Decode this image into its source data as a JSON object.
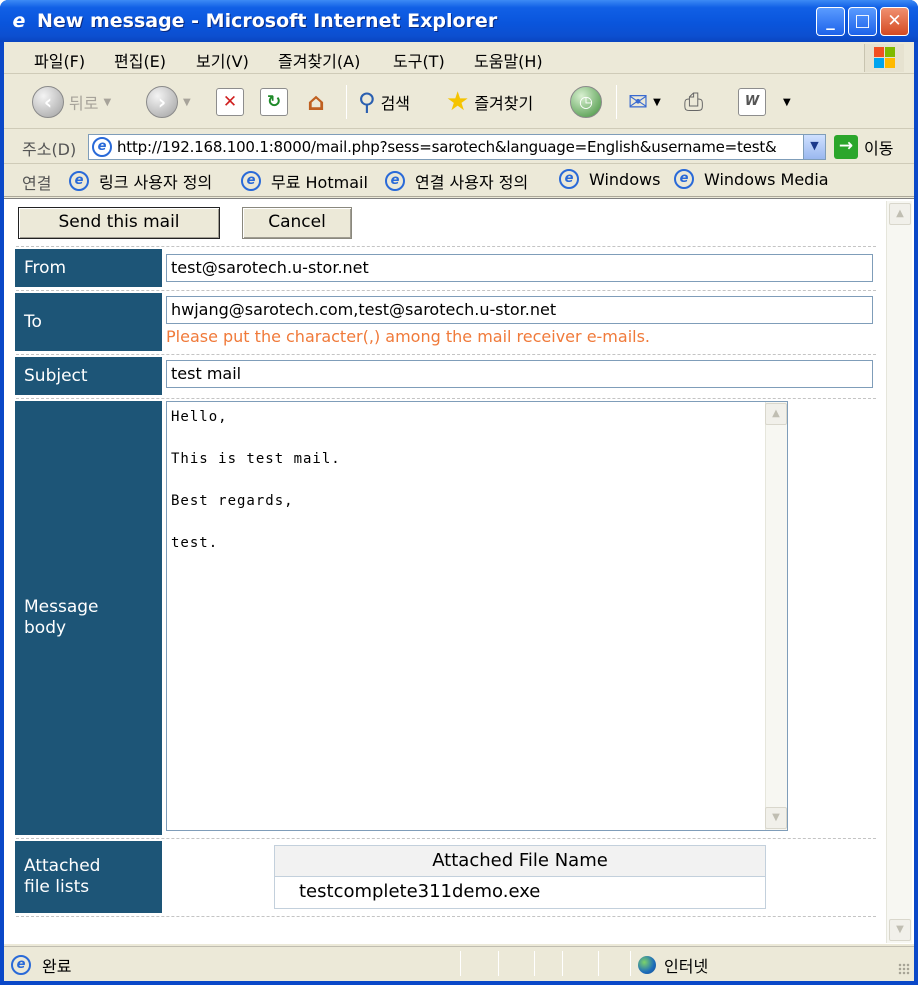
{
  "window": {
    "title": "New message - Microsoft Internet Explorer"
  },
  "menubar": {
    "items": [
      "파일(F)",
      "편집(E)",
      "보기(V)",
      "즐겨찾기(A)",
      "도구(T)",
      "도움말(H)"
    ]
  },
  "toolbar": {
    "back_label": "뒤로",
    "search_label": "검색",
    "favorites_label": "즐겨찾기"
  },
  "address": {
    "label": "주소(D)",
    "url": "http://192.168.100.1:8000/mail.php?sess=sarotech&language=English&username=test&",
    "go_label": "이동"
  },
  "links": {
    "label": "연결",
    "items": [
      "링크 사용자 정의",
      "무료 Hotmail",
      "연결 사용자 정의",
      "Windows",
      "Windows Media"
    ]
  },
  "compose": {
    "send_button": "Send this mail",
    "cancel_button": "Cancel",
    "from_label": "From",
    "from_value": "test@sarotech.u-stor.net",
    "to_label": "To",
    "to_value": "hwjang@sarotech.com,test@sarotech.u-stor.net",
    "to_hint": "Please put the character(,) among the mail receiver e-mails.",
    "subject_label": "Subject",
    "subject_value": "test mail",
    "body_label_line1": "Message",
    "body_label_line2": "body",
    "body_lines": [
      "Hello,",
      "This is test mail.",
      "Best regards,",
      "test."
    ],
    "attach_label_line1": "Attached",
    "attach_label_line2": "file lists",
    "attach_header": "Attached File Name",
    "attach_files": [
      "testcomplete311demo.exe"
    ]
  },
  "status": {
    "ready": "완료",
    "zone": "인터넷"
  },
  "colors": {
    "label_bg": "#1d5577",
    "hint_text": "#f07a3a",
    "titlebar": "#0a55dc"
  }
}
